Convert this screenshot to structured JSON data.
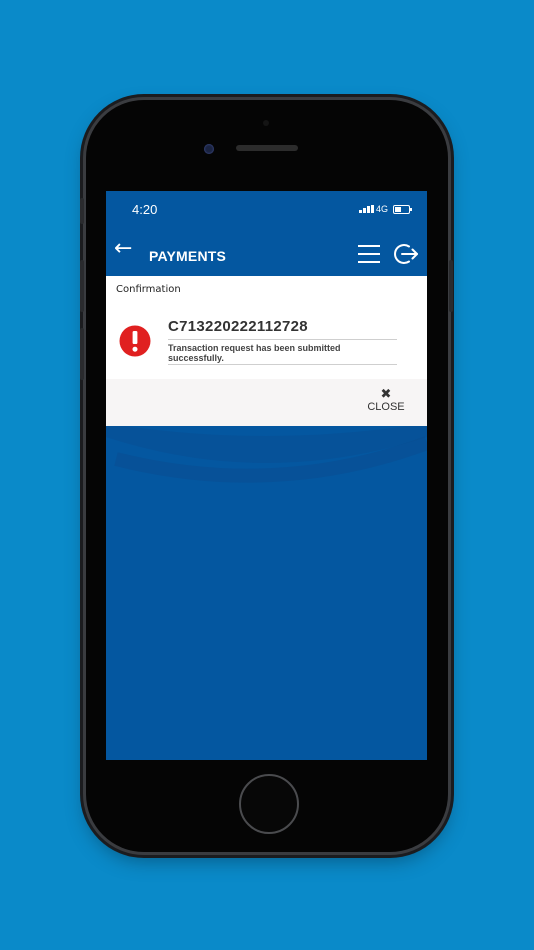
{
  "status_bar": {
    "time": "4:20",
    "network": "4G"
  },
  "app_bar": {
    "title": "PAYMENTS"
  },
  "confirmation": {
    "label": "Confirmation",
    "reference": "C713220222112728",
    "message": "Transaction request has been submitted successfully.",
    "close_label": "CLOSE"
  },
  "colors": {
    "background": "#0a8ac9",
    "app_blue": "#0457a0",
    "alert_red": "#e02020"
  },
  "icons": [
    "back-arrow-icon",
    "menu-icon",
    "logout-icon",
    "alert-icon",
    "close-icon"
  ]
}
